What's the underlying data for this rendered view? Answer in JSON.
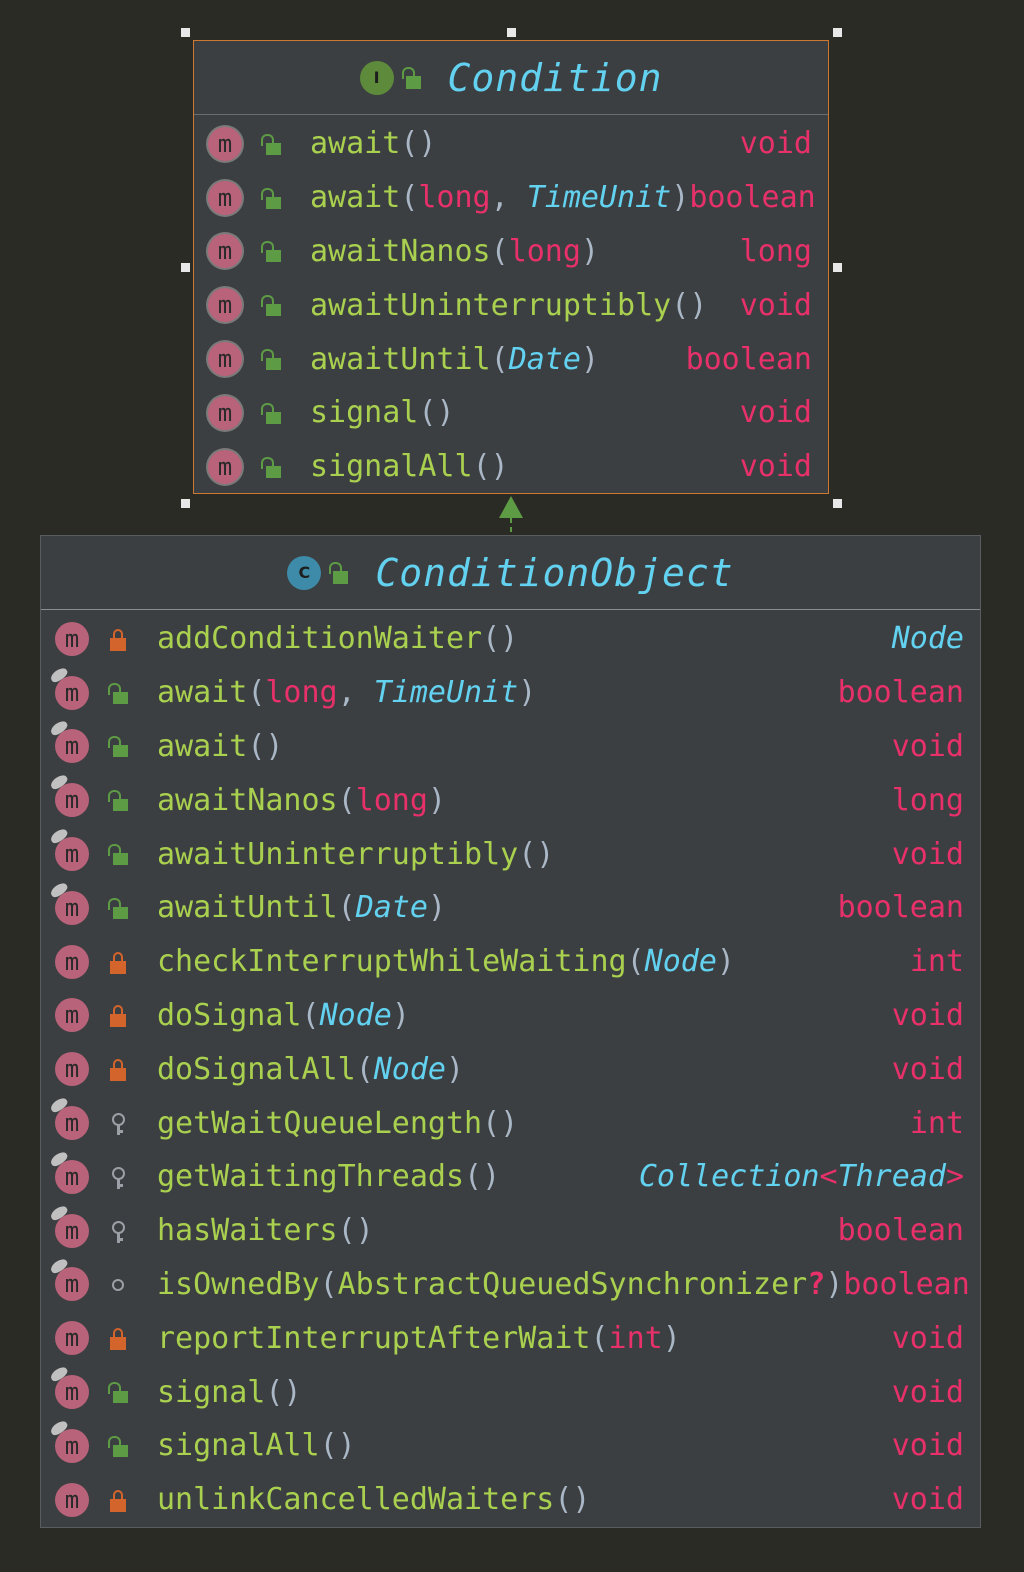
{
  "interface": {
    "kind_letter": "I",
    "name": "Condition",
    "methods": [
      {
        "name": "await",
        "params": [],
        "ret": "void",
        "ret_kind": "prim"
      },
      {
        "name": "await",
        "params": [
          {
            "t": "long",
            "k": "prim"
          },
          {
            "t": "TimeUnit",
            "k": "obj"
          }
        ],
        "ret": "boolean",
        "ret_kind": "prim"
      },
      {
        "name": "awaitNanos",
        "params": [
          {
            "t": "long",
            "k": "prim"
          }
        ],
        "ret": "long",
        "ret_kind": "prim"
      },
      {
        "name": "awaitUninterruptibly",
        "params": [],
        "ret": "void",
        "ret_kind": "prim"
      },
      {
        "name": "awaitUntil",
        "params": [
          {
            "t": "Date",
            "k": "obj"
          }
        ],
        "ret": "boolean",
        "ret_kind": "prim"
      },
      {
        "name": "signal",
        "params": [],
        "ret": "void",
        "ret_kind": "prim"
      },
      {
        "name": "signalAll",
        "params": [],
        "ret": "void",
        "ret_kind": "prim"
      }
    ]
  },
  "class": {
    "kind_letter": "C",
    "name": "ConditionObject",
    "methods": [
      {
        "name": "addConditionWaiter",
        "params": [],
        "ret": "Node",
        "ret_kind": "obj",
        "vis": "priv",
        "override": false
      },
      {
        "name": "await",
        "params": [
          {
            "t": "long",
            "k": "prim"
          },
          {
            "t": "TimeUnit",
            "k": "obj"
          }
        ],
        "ret": "boolean",
        "ret_kind": "prim",
        "vis": "pub",
        "override": true
      },
      {
        "name": "await",
        "params": [],
        "ret": "void",
        "ret_kind": "prim",
        "vis": "pub",
        "override": true
      },
      {
        "name": "awaitNanos",
        "params": [
          {
            "t": "long",
            "k": "prim"
          }
        ],
        "ret": "long",
        "ret_kind": "prim",
        "vis": "pub",
        "override": true
      },
      {
        "name": "awaitUninterruptibly",
        "params": [],
        "ret": "void",
        "ret_kind": "prim",
        "vis": "pub",
        "override": true
      },
      {
        "name": "awaitUntil",
        "params": [
          {
            "t": "Date",
            "k": "obj"
          }
        ],
        "ret": "boolean",
        "ret_kind": "prim",
        "vis": "pub",
        "override": true
      },
      {
        "name": "checkInterruptWhileWaiting",
        "params": [
          {
            "t": "Node",
            "k": "obj"
          }
        ],
        "ret": "int",
        "ret_kind": "prim",
        "vis": "priv",
        "override": false
      },
      {
        "name": "doSignal",
        "params": [
          {
            "t": "Node",
            "k": "obj"
          }
        ],
        "ret": "void",
        "ret_kind": "prim",
        "vis": "priv",
        "override": false
      },
      {
        "name": "doSignalAll",
        "params": [
          {
            "t": "Node",
            "k": "obj"
          }
        ],
        "ret": "void",
        "ret_kind": "prim",
        "vis": "priv",
        "override": false
      },
      {
        "name": "getWaitQueueLength",
        "params": [],
        "ret": "int",
        "ret_kind": "prim",
        "vis": "prot",
        "override": true
      },
      {
        "name": "getWaitingThreads",
        "params": [],
        "ret": "Collection<Thread>",
        "ret_kind": "generic",
        "ret_outer": "Collection",
        "ret_inner": "Thread",
        "vis": "prot",
        "override": true
      },
      {
        "name": "hasWaiters",
        "params": [],
        "ret": "boolean",
        "ret_kind": "prim",
        "vis": "prot",
        "override": true
      },
      {
        "name": "isOwnedBy",
        "params": [
          {
            "t": "AbstractQueuedSynchronizer",
            "k": "plain",
            "nullable": "?"
          }
        ],
        "ret": "boolean",
        "ret_kind": "prim",
        "vis": "pkg",
        "override": true
      },
      {
        "name": "reportInterruptAfterWait",
        "params": [
          {
            "t": "int",
            "k": "prim"
          }
        ],
        "ret": "void",
        "ret_kind": "prim",
        "vis": "priv",
        "override": false
      },
      {
        "name": "signal",
        "params": [],
        "ret": "void",
        "ret_kind": "prim",
        "vis": "pub",
        "override": true
      },
      {
        "name": "signalAll",
        "params": [],
        "ret": "void",
        "ret_kind": "prim",
        "vis": "pub",
        "override": true
      },
      {
        "name": "unlinkCancelledWaiters",
        "params": [],
        "ret": "void",
        "ret_kind": "prim",
        "vis": "priv",
        "override": false
      }
    ]
  },
  "method_icon_letter": "m",
  "colors": {
    "interface_border": "#cc7832",
    "method_name": "#a9d04f",
    "primitive": "#e8306a",
    "object_type": "#62d2f0",
    "title": "#62d2f0"
  }
}
